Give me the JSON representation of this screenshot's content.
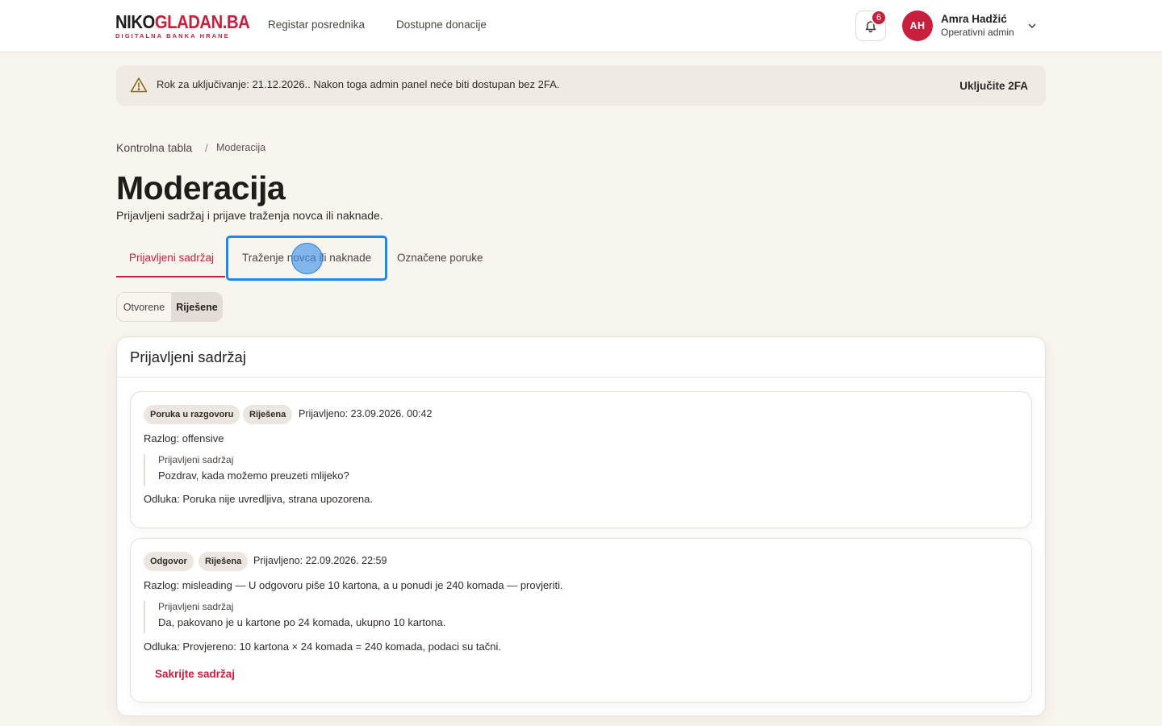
{
  "header": {
    "logo_main_dark": "NIKO",
    "logo_main_red": "GLADAN.BA",
    "logo_sub": "DIGITALNA BANKA HRANE",
    "nav": [
      "Registar posrednika",
      "Dostupne donacije"
    ],
    "notifications_count": "6",
    "user": {
      "initials": "AH",
      "name": "Amra Hadžić",
      "role": "Operativni admin"
    }
  },
  "alert": {
    "text": "Rok za uključivanje: 21.12.2026.. Nakon toga admin panel neće biti dostupan bez 2FA.",
    "action": "Uključite 2FA"
  },
  "breadcrumb": {
    "parent": "Kontrolna tabla",
    "separator": "/",
    "current": "Moderacija"
  },
  "page": {
    "title": "Moderacija",
    "subtitle": "Prijavljeni sadržaj i prijave traženja novca ili naknade."
  },
  "tabs": [
    {
      "label": "Prijavljeni sadržaj",
      "active": true
    },
    {
      "label": "Traženje novca ili naknade",
      "active": false
    },
    {
      "label": "Označene poruke",
      "active": false
    }
  ],
  "filter": {
    "options": [
      "Otvorene",
      "Riješene"
    ],
    "selected": "Riješene"
  },
  "panel": {
    "title": "Prijavljeni sadržaj",
    "reports": [
      {
        "type": "Poruka u razgovoru",
        "status": "Riješena",
        "reported": "Prijavljeno: 23.09.2026. 00:42",
        "reason": "Razlog: offensive",
        "quote_label": "Prijavljeni sadržaj",
        "quote_text": "Pozdrav, kada možemo preuzeti mlijeko?",
        "decision": "Odluka: Poruka nije uvredljiva, strana upozorena."
      },
      {
        "type": "Odgovor",
        "status": "Riješena",
        "reported": "Prijavljeno: 22.09.2026. 22:59",
        "reason": "Razlog: misleading — U odgovoru piše 10 kartona, a u ponudi je 240 komada — provjeriti.",
        "quote_label": "Prijavljeni sadržaj",
        "quote_text": "Da, pakovano je u kartone po 24 komada, ukupno 10 kartona.",
        "decision": "Odluka: Provjereno: 10 kartona × 24 komada = 240 komada, podaci su tačni.",
        "action": "Sakrijte sadržaj"
      }
    ]
  },
  "colors": {
    "brand_red": "#c8203c",
    "focus_blue": "#1f88f0",
    "page_bg": "#f8f4ee"
  }
}
